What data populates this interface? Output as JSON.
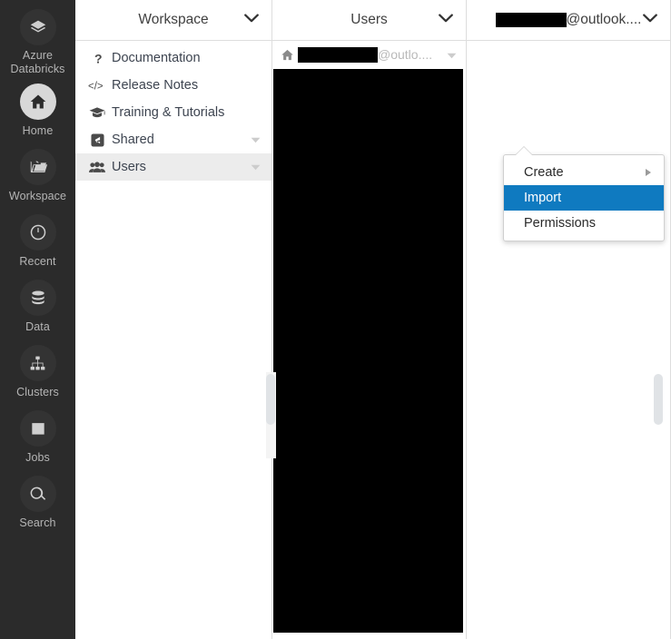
{
  "nav_rail": {
    "items": [
      {
        "label": "Azure Databricks",
        "icon": "layers-icon",
        "selected": false
      },
      {
        "label": "Home",
        "icon": "home-icon",
        "selected": true
      },
      {
        "label": "Workspace",
        "icon": "folder-icon",
        "selected": false
      },
      {
        "label": "Recent",
        "icon": "clock-icon",
        "selected": false
      },
      {
        "label": "Data",
        "icon": "database-icon",
        "selected": false
      },
      {
        "label": "Clusters",
        "icon": "clusters-icon",
        "selected": false
      },
      {
        "label": "Jobs",
        "icon": "calendar-icon",
        "selected": false
      },
      {
        "label": "Search",
        "icon": "search-icon",
        "selected": false
      }
    ]
  },
  "panes": {
    "workspace": {
      "header_title": "Workspace",
      "header_chevron_icon": "chevron-down-icon",
      "items": [
        {
          "label": "Documentation",
          "icon": "question-mark-icon",
          "caret": false,
          "selected": false
        },
        {
          "label": "Release Notes",
          "icon": "code-tag-icon",
          "caret": false,
          "selected": false
        },
        {
          "label": "Training & Tutorials",
          "icon": "graduation-cap-icon",
          "caret": false,
          "selected": false
        },
        {
          "label": "Shared",
          "icon": "share-icon",
          "caret": true,
          "selected": false
        },
        {
          "label": "Users",
          "icon": "people-icon",
          "caret": true,
          "selected": true
        }
      ]
    },
    "users": {
      "header_title": "Users",
      "header_chevron_icon": "chevron-down-icon",
      "row": {
        "icon": "home-icon",
        "redacted_prefix": "",
        "text": "@outlo....",
        "caret_icon": "caret-down-icon"
      }
    },
    "user": {
      "header_redacted_prefix": "",
      "header_title": "@outlook....",
      "header_chevron_icon": "chevron-down-icon"
    }
  },
  "context_menu": {
    "highlight_color": "#0f7ac0",
    "items": [
      {
        "label": "Create",
        "submenu": true,
        "highlighted": false
      },
      {
        "label": "Import",
        "submenu": false,
        "highlighted": true
      },
      {
        "label": "Permissions",
        "submenu": false,
        "highlighted": false
      }
    ]
  }
}
